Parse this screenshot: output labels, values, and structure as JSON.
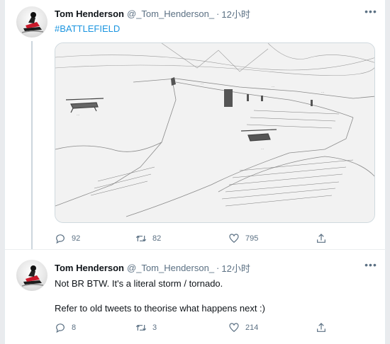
{
  "colors": {
    "link": "#1b95e0",
    "muted": "#5b7083",
    "text": "#0f1419",
    "border": "#ebeef0"
  },
  "tweets": [
    {
      "author": {
        "name": "Tom Henderson",
        "handle": "@_Tom_Henderson_",
        "separator": "·",
        "time": "12小时"
      },
      "hashtag": "#BATTLEFIELD",
      "media": {
        "type": "pencil-sketch-image"
      },
      "actions": {
        "reply_count": "92",
        "retweet_count": "82",
        "like_count": "795"
      }
    },
    {
      "author": {
        "name": "Tom Henderson",
        "handle": "@_Tom_Henderson_",
        "separator": "·",
        "time": "12小时"
      },
      "text_lines": [
        "Not BR BTW. It's a literal storm / tornado.",
        "Refer to old tweets to theorise what happens next :)"
      ],
      "actions": {
        "reply_count": "8",
        "retweet_count": "3",
        "like_count": "214"
      }
    }
  ],
  "icons": {
    "more": "more-horizontal-icon",
    "reply": "reply-icon",
    "retweet": "retweet-icon",
    "like": "heart-icon",
    "share": "share-icon"
  }
}
